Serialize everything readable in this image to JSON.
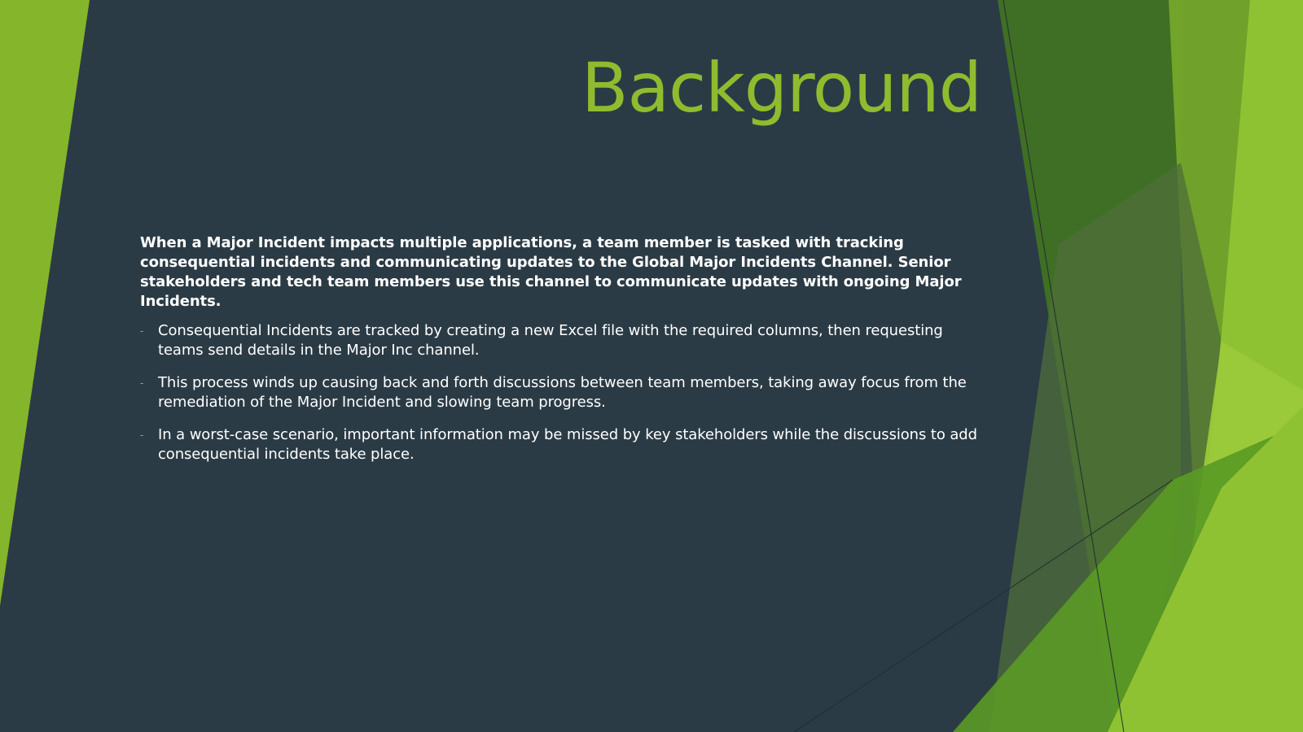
{
  "slide": {
    "title": "Background",
    "intro": "When a Major Incident impacts multiple applications, a team member is tasked with tracking consequential incidents and communicating updates to the Global Major Incidents Channel. Senior stakeholders and tech team members use this channel to communicate updates with ongoing Major Incidents.",
    "bullet_marker": "-",
    "bullets": [
      {
        "text": "Consequential Incidents are tracked by creating a new Excel file with the required columns, then requesting teams send details in the Major Inc channel."
      },
      {
        "text": "This process winds up causing back and forth discussions between team members, taking away focus from the remediation of the Major Incident and slowing team progress."
      },
      {
        "text": "In a worst-case scenario, important information may be missed by key stakeholders while the discussions to add consequential incidents take place."
      }
    ]
  },
  "theme": {
    "background": "#2b3b45",
    "accent_green": "#8fbc2f",
    "dark_green": "#3f6f24",
    "mid_green": "#73a82a",
    "light_green": "#9ccb3c",
    "text": "#ffffff"
  }
}
